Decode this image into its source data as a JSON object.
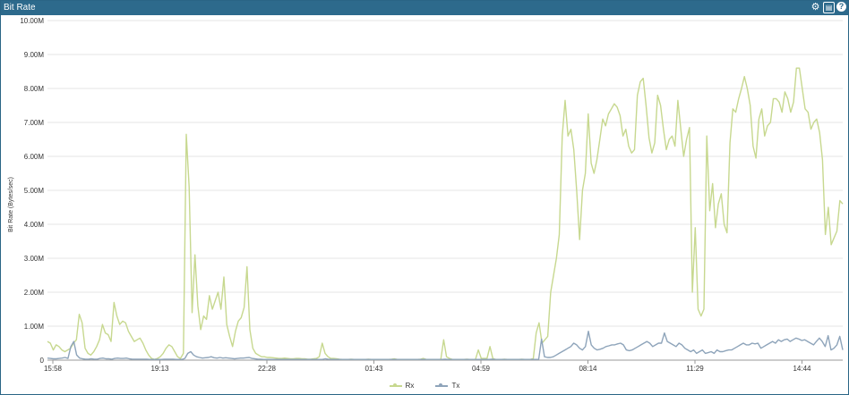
{
  "panel": {
    "title": "Bit Rate",
    "icons": [
      "gear-icon",
      "export-icon",
      "help-icon"
    ]
  },
  "colors": {
    "titlebar": "#2d6a8c",
    "rx": "#c7d88f",
    "tx": "#8ea4ba",
    "grid": "#e6e6e6"
  },
  "chart_data": {
    "type": "line",
    "ylabel": "Bit Rate (Bytes/sec)",
    "xlabel": "",
    "ylim": [
      0,
      10000000
    ],
    "yticks": [
      {
        "v": 0,
        "label": "0"
      },
      {
        "v": 1000000,
        "label": "1.00M"
      },
      {
        "v": 2000000,
        "label": "2.00M"
      },
      {
        "v": 3000000,
        "label": "3.00M"
      },
      {
        "v": 4000000,
        "label": "4.00M"
      },
      {
        "v": 5000000,
        "label": "5.00M"
      },
      {
        "v": 6000000,
        "label": "6.00M"
      },
      {
        "v": 7000000,
        "label": "7.00M"
      },
      {
        "v": 8000000,
        "label": "8.00M"
      },
      {
        "v": 9000000,
        "label": "9.00M"
      },
      {
        "v": 10000000,
        "label": "10.00M"
      }
    ],
    "x_ticks": [
      "15:58",
      "19:13",
      "22:28",
      "01:43",
      "04:59",
      "08:14",
      "11:29",
      "14:44"
    ],
    "legend": [
      "Rx",
      "Tx"
    ],
    "grid": true,
    "legend_position": "bottom-center",
    "series": [
      {
        "name": "Rx",
        "values": [
          0.55,
          0.5,
          0.3,
          0.45,
          0.4,
          0.3,
          0.25,
          0.3,
          0.35,
          0.5,
          0.6,
          1.35,
          1.1,
          0.35,
          0.2,
          0.15,
          0.25,
          0.4,
          0.6,
          1.05,
          0.8,
          0.75,
          0.55,
          1.7,
          1.3,
          1.05,
          1.15,
          1.1,
          0.85,
          0.7,
          0.55,
          0.6,
          0.65,
          0.5,
          0.3,
          0.15,
          0.05,
          0.02,
          0.05,
          0.1,
          0.2,
          0.35,
          0.45,
          0.4,
          0.25,
          0.1,
          0.05,
          0.2,
          6.65,
          5.1,
          1.4,
          3.1,
          1.6,
          0.9,
          1.3,
          1.2,
          1.9,
          1.5,
          1.75,
          2.0,
          1.5,
          2.45,
          1.05,
          0.7,
          0.4,
          0.85,
          1.15,
          1.25,
          1.55,
          2.75,
          0.9,
          0.35,
          0.2,
          0.15,
          0.1,
          0.1,
          0.08,
          0.08,
          0.07,
          0.06,
          0.05,
          0.05,
          0.06,
          0.05,
          0.04,
          0.04,
          0.05,
          0.05,
          0.04,
          0.04,
          0.03,
          0.03,
          0.04,
          0.05,
          0.1,
          0.5,
          0.2,
          0.1,
          0.05,
          0.05,
          0.04,
          0.03,
          0.02,
          0.02,
          0.02,
          0.03,
          0.02,
          0.02,
          0.02,
          0.02,
          0.02,
          0.03,
          0.02,
          0.02,
          0.02,
          0.02,
          0.02,
          0.02,
          0.02,
          0.03,
          0.04,
          0.02,
          0.02,
          0.02,
          0.02,
          0.02,
          0.02,
          0.02,
          0.02,
          0.03,
          0.05,
          0.02,
          0.02,
          0.02,
          0.02,
          0.02,
          0.02,
          0.6,
          0.1,
          0.05,
          0.02,
          0.02,
          0.02,
          0.02,
          0.02,
          0.03,
          0.02,
          0.02,
          0.02,
          0.3,
          0.05,
          0.05,
          0.05,
          0.4,
          0.05,
          0.02,
          0.02,
          0.02,
          0.03,
          0.02,
          0.02,
          0.02,
          0.02,
          0.02,
          0.03,
          0.02,
          0.02,
          0.02,
          0.05,
          0.8,
          1.1,
          0.5,
          0.6,
          0.7,
          2.0,
          2.5,
          3.0,
          3.7,
          6.6,
          7.65,
          6.6,
          6.8,
          6.2,
          5.0,
          3.55,
          5.0,
          5.5,
          7.25,
          5.8,
          5.5,
          5.9,
          6.5,
          7.1,
          6.9,
          7.25,
          7.4,
          7.55,
          7.45,
          7.2,
          6.6,
          6.8,
          6.3,
          6.1,
          6.2,
          7.8,
          8.2,
          8.3,
          7.5,
          6.55,
          6.1,
          6.4,
          7.8,
          7.5,
          6.8,
          6.2,
          6.5,
          6.6,
          6.3,
          7.65,
          6.8,
          6.0,
          6.5,
          6.85,
          2.0,
          3.9,
          1.5,
          1.3,
          1.5,
          6.6,
          4.4,
          5.2,
          3.9,
          4.6,
          4.9,
          4.0,
          3.75,
          6.4,
          7.4,
          7.3,
          7.7,
          8.0,
          8.35,
          8.0,
          7.5,
          6.3,
          5.95,
          7.1,
          7.4,
          6.6,
          6.9,
          7.0,
          7.7,
          7.7,
          7.6,
          7.3,
          7.9,
          7.7,
          7.3,
          7.6,
          8.6,
          8.6,
          8.0,
          7.4,
          7.3,
          6.8,
          7.0,
          7.1,
          6.7,
          5.9,
          3.7,
          4.5,
          3.4,
          3.6,
          3.8,
          4.7,
          4.6
        ]
      },
      {
        "name": "Tx",
        "values": [
          0.06,
          0.05,
          0.04,
          0.04,
          0.05,
          0.06,
          0.08,
          0.05,
          0.4,
          0.55,
          0.15,
          0.06,
          0.04,
          0.03,
          0.03,
          0.04,
          0.03,
          0.03,
          0.05,
          0.06,
          0.04,
          0.04,
          0.03,
          0.05,
          0.06,
          0.05,
          0.05,
          0.06,
          0.04,
          0.03,
          0.03,
          0.03,
          0.03,
          0.03,
          0.03,
          0.02,
          0.02,
          0.02,
          0.02,
          0.02,
          0.03,
          0.03,
          0.03,
          0.03,
          0.02,
          0.02,
          0.02,
          0.05,
          0.2,
          0.25,
          0.15,
          0.1,
          0.08,
          0.06,
          0.07,
          0.08,
          0.1,
          0.07,
          0.06,
          0.08,
          0.06,
          0.07,
          0.06,
          0.05,
          0.04,
          0.05,
          0.06,
          0.06,
          0.07,
          0.08,
          0.05,
          0.04,
          0.03,
          0.03,
          0.02,
          0.02,
          0.02,
          0.02,
          0.02,
          0.02,
          0.02,
          0.02,
          0.02,
          0.02,
          0.02,
          0.02,
          0.02,
          0.02,
          0.02,
          0.02,
          0.02,
          0.02,
          0.02,
          0.02,
          0.02,
          0.04,
          0.03,
          0.02,
          0.02,
          0.02,
          0.02,
          0.02,
          0.02,
          0.02,
          0.02,
          0.02,
          0.02,
          0.02,
          0.02,
          0.02,
          0.02,
          0.02,
          0.02,
          0.02,
          0.02,
          0.02,
          0.02,
          0.02,
          0.02,
          0.02,
          0.02,
          0.02,
          0.02,
          0.02,
          0.02,
          0.02,
          0.02,
          0.02,
          0.02,
          0.02,
          0.02,
          0.02,
          0.02,
          0.02,
          0.02,
          0.02,
          0.03,
          0.02,
          0.02,
          0.02,
          0.02,
          0.02,
          0.02,
          0.02,
          0.02,
          0.02,
          0.02,
          0.02,
          0.02,
          0.02,
          0.02,
          0.02,
          0.03,
          0.02,
          0.02,
          0.02,
          0.02,
          0.02,
          0.02,
          0.02,
          0.02,
          0.02,
          0.02,
          0.02,
          0.02,
          0.02,
          0.02,
          0.02,
          0.02,
          0.62,
          0.1,
          0.08,
          0.08,
          0.1,
          0.15,
          0.2,
          0.25,
          0.3,
          0.35,
          0.4,
          0.5,
          0.45,
          0.35,
          0.3,
          0.4,
          0.85,
          0.45,
          0.35,
          0.3,
          0.32,
          0.35,
          0.4,
          0.42,
          0.45,
          0.45,
          0.48,
          0.5,
          0.45,
          0.3,
          0.28,
          0.3,
          0.35,
          0.4,
          0.45,
          0.5,
          0.55,
          0.5,
          0.4,
          0.45,
          0.5,
          0.5,
          0.8,
          0.55,
          0.5,
          0.45,
          0.4,
          0.5,
          0.45,
          0.35,
          0.3,
          0.25,
          0.3,
          0.2,
          0.25,
          0.3,
          0.2,
          0.22,
          0.25,
          0.2,
          0.3,
          0.25,
          0.25,
          0.28,
          0.3,
          0.3,
          0.35,
          0.4,
          0.45,
          0.5,
          0.45,
          0.45,
          0.5,
          0.48,
          0.5,
          0.35,
          0.4,
          0.45,
          0.5,
          0.55,
          0.5,
          0.6,
          0.55,
          0.6,
          0.62,
          0.55,
          0.6,
          0.65,
          0.62,
          0.58,
          0.6,
          0.55,
          0.5,
          0.45,
          0.55,
          0.65,
          0.55,
          0.4,
          0.72,
          0.3,
          0.35,
          0.45,
          0.7,
          0.3
        ]
      }
    ]
  }
}
